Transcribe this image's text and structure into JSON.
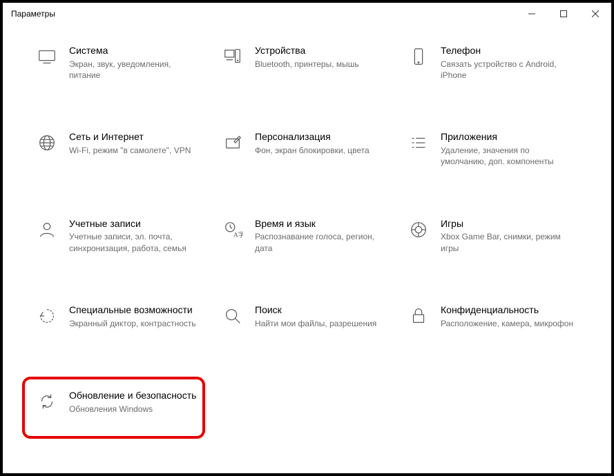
{
  "window": {
    "title": "Параметры"
  },
  "tiles": [
    {
      "id": "system",
      "title": "Система",
      "desc": "Экран, звук, уведомления, питание"
    },
    {
      "id": "devices",
      "title": "Устройства",
      "desc": "Bluetooth, принтеры, мышь"
    },
    {
      "id": "phone",
      "title": "Телефон",
      "desc": "Связать устройство с Android, iPhone"
    },
    {
      "id": "network",
      "title": "Сеть и Интернет",
      "desc": "Wi-Fi, режим \"в самолете\", VPN"
    },
    {
      "id": "personalization",
      "title": "Персонализация",
      "desc": "Фон, экран блокировки, цвета"
    },
    {
      "id": "apps",
      "title": "Приложения",
      "desc": "Удаление, значения по умолчанию, доп. компоненты"
    },
    {
      "id": "accounts",
      "title": "Учетные записи",
      "desc": "Учетные записи, эл. почта, синхронизация, работа, семья"
    },
    {
      "id": "time",
      "title": "Время и язык",
      "desc": "Распознавание голоса, регион, дата"
    },
    {
      "id": "gaming",
      "title": "Игры",
      "desc": "Xbox Game Bar, снимки, режим игры"
    },
    {
      "id": "ease",
      "title": "Специальные возможности",
      "desc": "Экранный диктор, контрастность"
    },
    {
      "id": "search",
      "title": "Поиск",
      "desc": "Найти мои файлы, разрешения"
    },
    {
      "id": "privacy",
      "title": "Конфиденциальность",
      "desc": "Расположение, камера, микрофон"
    },
    {
      "id": "update",
      "title": "Обновление и безопасность",
      "desc": "Обновления Windows"
    }
  ]
}
